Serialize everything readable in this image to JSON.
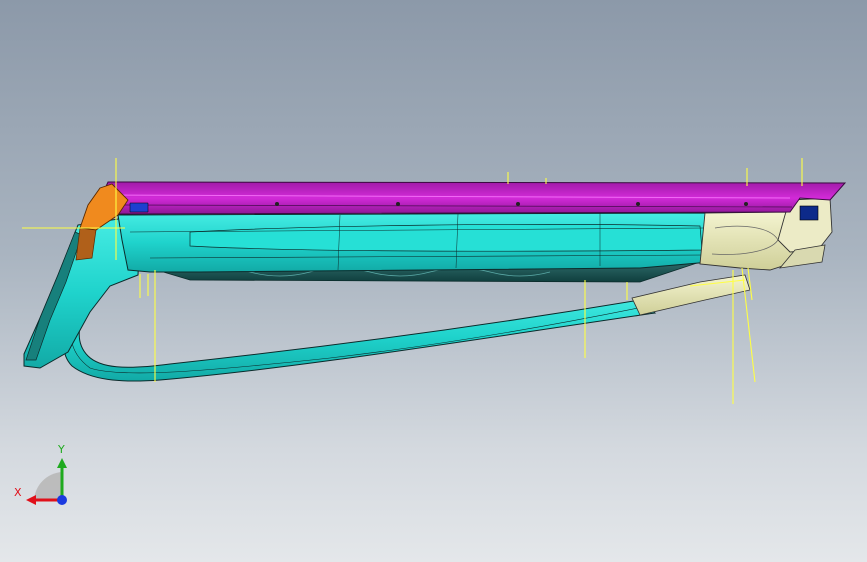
{
  "viewport": {
    "colors": {
      "bg_top": "#8c99a9",
      "bg_bottom": "#e4e7ea",
      "magenta": "#c020c8",
      "cyan": "#1fd7cf",
      "cream": "#e6e6b8",
      "orange": "#f08a1e",
      "edge": "#0b2b2b",
      "guide": "#ffff44"
    }
  },
  "triad": {
    "x_label": "X",
    "y_label": "Y",
    "x_color": "#e0101a",
    "y_color": "#1faa1f",
    "z_color": "#1a3ae0"
  }
}
